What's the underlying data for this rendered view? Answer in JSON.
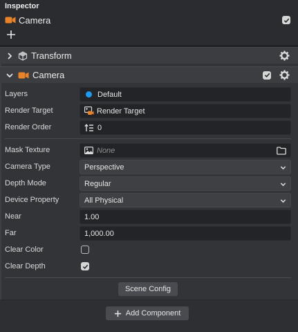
{
  "panel": {
    "title": "Inspector"
  },
  "entity": {
    "name": "Camera",
    "enabled": true
  },
  "components": {
    "transform": {
      "title": "Transform",
      "icon": "transform-cube-icon"
    },
    "camera": {
      "title": "Camera",
      "icon": "camera-icon",
      "enabled": true
    }
  },
  "fields": {
    "layers": {
      "label": "Layers",
      "value": "Default",
      "dot_color": "#1e9bf0"
    },
    "render_target": {
      "label": "Render Target",
      "value": "Render Target"
    },
    "render_order": {
      "label": "Render Order",
      "value": "0"
    },
    "mask_texture": {
      "label": "Mask Texture",
      "placeholder": "None"
    },
    "camera_type": {
      "label": "Camera Type",
      "value": "Perspective"
    },
    "depth_mode": {
      "label": "Depth Mode",
      "value": "Regular"
    },
    "device_property": {
      "label": "Device Property",
      "value": "All Physical"
    },
    "near": {
      "label": "Near",
      "value": "1.00"
    },
    "far": {
      "label": "Far",
      "value": "1,000.00"
    },
    "clear_color": {
      "label": "Clear Color",
      "checked": false
    },
    "clear_depth": {
      "label": "Clear Depth",
      "checked": true
    }
  },
  "buttons": {
    "scene_config": "Scene Config",
    "add_component": "Add Component"
  },
  "colors": {
    "accent_orange": "#e8832a",
    "accent_blue": "#1e9bf0"
  }
}
